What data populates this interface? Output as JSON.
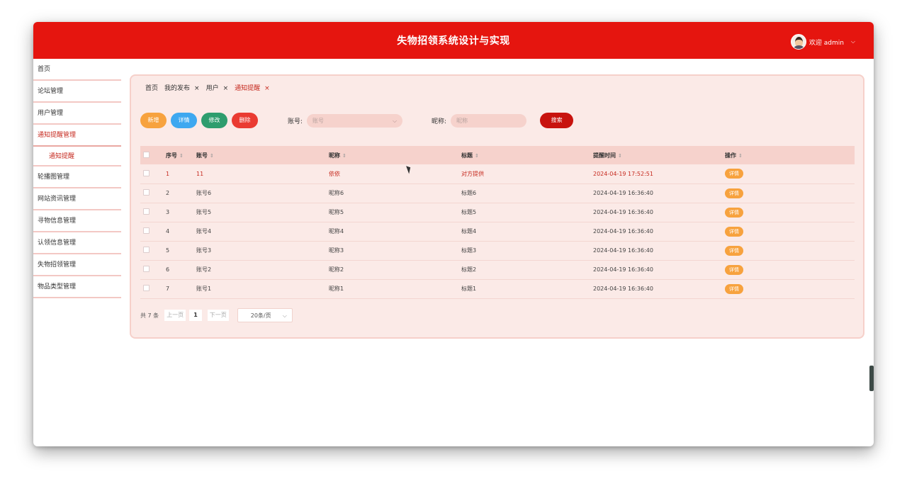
{
  "header": {
    "title": "失物招领系统设计与实现",
    "welcome": "欢迎 admin",
    "caret": "⌵"
  },
  "sidebar": {
    "items": [
      {
        "label": "首页",
        "state": "normal"
      },
      {
        "label": "论坛管理",
        "state": "normal"
      },
      {
        "label": "用户管理",
        "state": "normal"
      },
      {
        "label": "通知提醒管理",
        "state": "active"
      },
      {
        "label": "通知提醒",
        "state": "sub"
      },
      {
        "label": "轮播图管理",
        "state": "normal"
      },
      {
        "label": "网站资讯管理",
        "state": "normal"
      },
      {
        "label": "寻物信息管理",
        "state": "normal"
      },
      {
        "label": "认领信息管理",
        "state": "normal"
      },
      {
        "label": "失物招领管理",
        "state": "normal"
      },
      {
        "label": "物品类型管理",
        "state": "normal"
      }
    ]
  },
  "tabs": [
    {
      "label": "首页",
      "closable": false,
      "active": false
    },
    {
      "label": "我的发布",
      "closable": true,
      "active": false
    },
    {
      "label": "用户",
      "closable": true,
      "active": false
    },
    {
      "label": "通知提醒",
      "closable": true,
      "active": true
    }
  ],
  "toolbar": {
    "add": "新增",
    "detail": "详情",
    "edit": "修改",
    "delete": "删除",
    "account_label": "账号:",
    "account_placeholder": "账号",
    "nickname_label": "昵称:",
    "nickname_placeholder": "昵称",
    "search": "搜索"
  },
  "table": {
    "columns": [
      "序号",
      "账号",
      "昵称",
      "标题",
      "提醒时间",
      "操作"
    ],
    "action_label": "详情",
    "rows": [
      [
        "1",
        "11",
        "依依",
        "对方提供",
        "2024-04-19 17:52:51"
      ],
      [
        "2",
        "账号6",
        "昵称6",
        "标题6",
        "2024-04-19 16:36:40"
      ],
      [
        "3",
        "账号5",
        "昵称5",
        "标题5",
        "2024-04-19 16:36:40"
      ],
      [
        "4",
        "账号4",
        "昵称4",
        "标题4",
        "2024-04-19 16:36:40"
      ],
      [
        "5",
        "账号3",
        "昵称3",
        "标题3",
        "2024-04-19 16:36:40"
      ],
      [
        "6",
        "账号2",
        "昵称2",
        "标题2",
        "2024-04-19 16:36:40"
      ],
      [
        "7",
        "账号1",
        "昵称1",
        "标题1",
        "2024-04-19 16:36:40"
      ]
    ]
  },
  "pager": {
    "total": "共 7 条",
    "prev": "上一页",
    "current": "1",
    "next": "下一页",
    "page_size": "20条/页"
  },
  "colors": {
    "header": "#e5150f",
    "active": "#c62a1f",
    "panel": "#fbeae7"
  }
}
